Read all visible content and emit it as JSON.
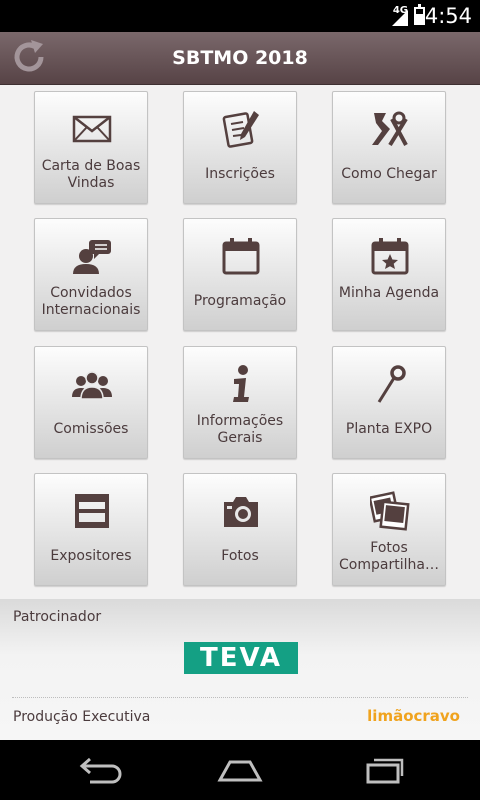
{
  "status": {
    "network": "4G",
    "time": "4:54"
  },
  "app": {
    "title": "SBTMO 2018"
  },
  "tiles": [
    {
      "label": "Carta de Boas Vindas",
      "icon": "envelope-icon"
    },
    {
      "label": "Inscrições",
      "icon": "document-pen-icon"
    },
    {
      "label": "Como Chegar",
      "icon": "road-map-icon"
    },
    {
      "label": "Convidados Internacionais",
      "icon": "person-speech-icon"
    },
    {
      "label": "Programação",
      "icon": "calendar-icon"
    },
    {
      "label": "Minha Agenda",
      "icon": "calendar-star-icon"
    },
    {
      "label": "Comissões",
      "icon": "group-people-icon"
    },
    {
      "label": "Informações Gerais",
      "icon": "info-icon"
    },
    {
      "label": "Planta EXPO",
      "icon": "map-pin-icon"
    },
    {
      "label": "Expositores",
      "icon": "booth-icon"
    },
    {
      "label": "Fotos",
      "icon": "camera-icon"
    },
    {
      "label": "Fotos Compartilha…",
      "icon": "photos-stack-icon"
    }
  ],
  "footer": {
    "sponsor_label": "Patrocinador",
    "sponsor_logo": "TEVA",
    "producer_label": "Produção Executiva",
    "producer_logo": "limãocravo"
  },
  "colors": {
    "appbar": "#574346",
    "icon": "#54403f",
    "label": "#4b3b3d",
    "teva": "#14a084",
    "limao": "#f0a31e"
  }
}
